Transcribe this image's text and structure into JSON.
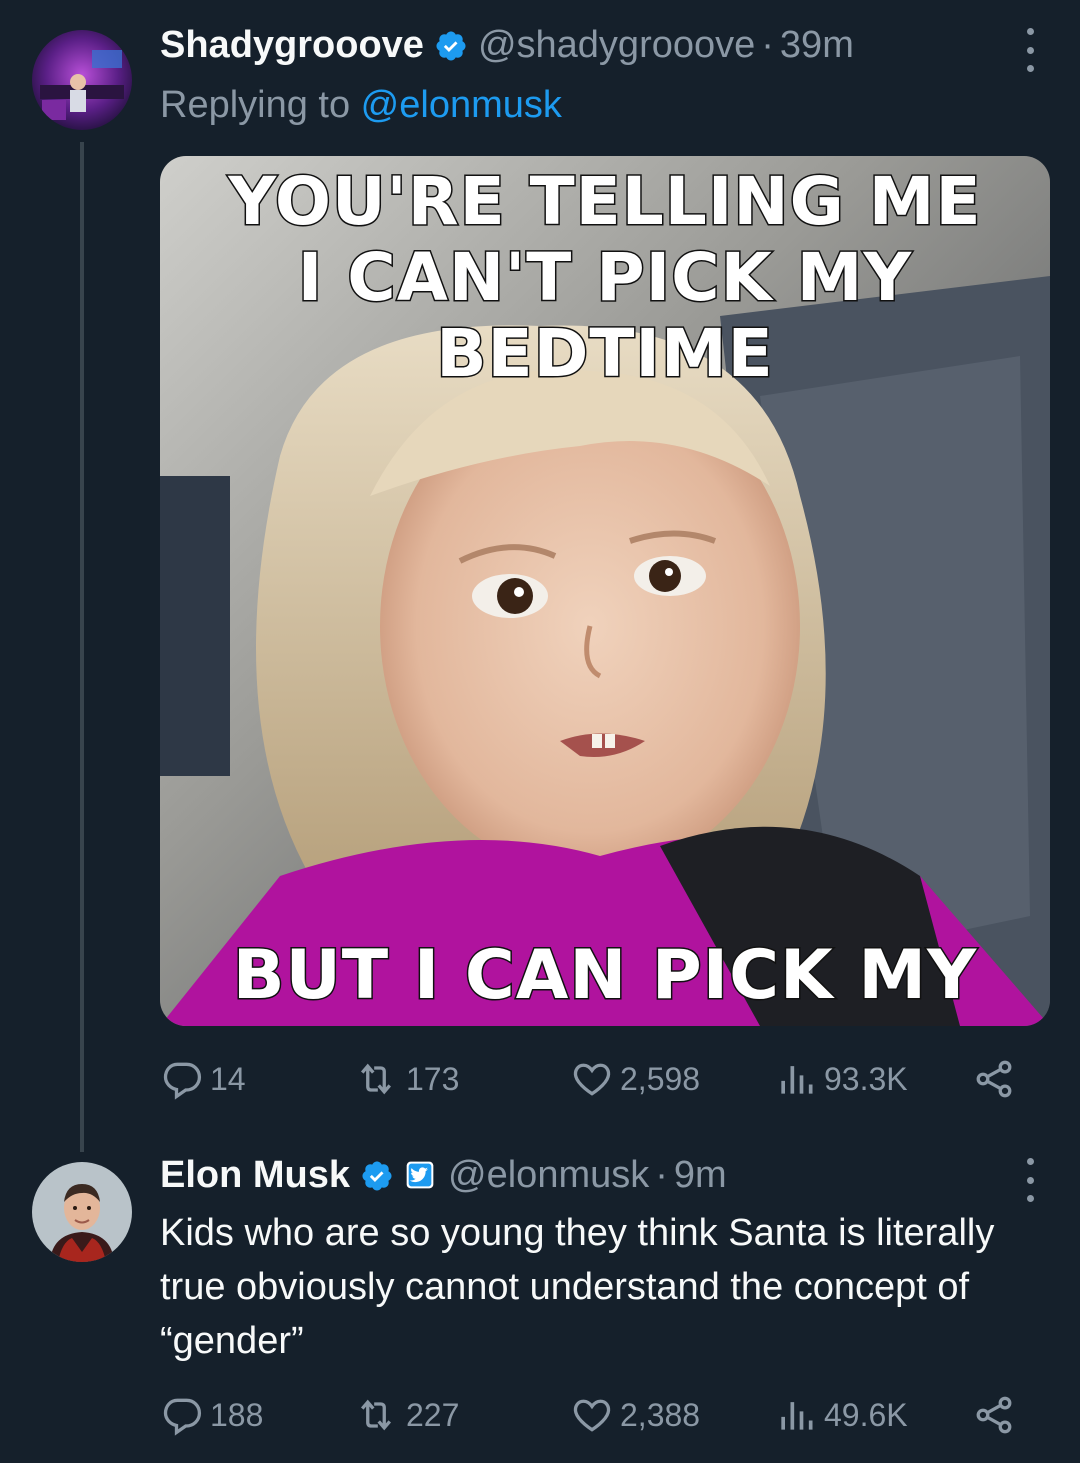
{
  "tweet1": {
    "display_name": "Shadygrooove",
    "handle": "@shadygrooove",
    "separator": "·",
    "time": "39m",
    "replying_prefix": "Replying to ",
    "replying_to": "@elonmusk",
    "media": {
      "top_text_line1": "YOU'RE TELLING ME",
      "top_text_line2": "I CAN'T PICK MY BEDTIME",
      "bottom_text": "BUT I CAN PICK MY GENDER?"
    },
    "stats": {
      "replies": "14",
      "retweets": "173",
      "likes": "2,598",
      "views": "93.3K"
    }
  },
  "tweet2": {
    "display_name": "Elon Musk",
    "handle": "@elonmusk",
    "separator": "·",
    "time": "9m",
    "text": "Kids who are so young they think Santa is literally true obviously cannot understand the concept of “gender”",
    "stats": {
      "replies": "188",
      "retweets": "227",
      "likes": "2,388",
      "views": "49.6K"
    }
  },
  "colors": {
    "background": "#15202b",
    "text_primary": "#f7f9f9",
    "text_secondary": "#8b98a5",
    "accent": "#1d9bf0",
    "thread_line": "#38444d"
  },
  "icons": [
    "more-icon",
    "verified-badge-icon",
    "reply-icon",
    "retweet-icon",
    "like-icon",
    "views-icon",
    "share-icon",
    "affiliate-badge-icon"
  ]
}
